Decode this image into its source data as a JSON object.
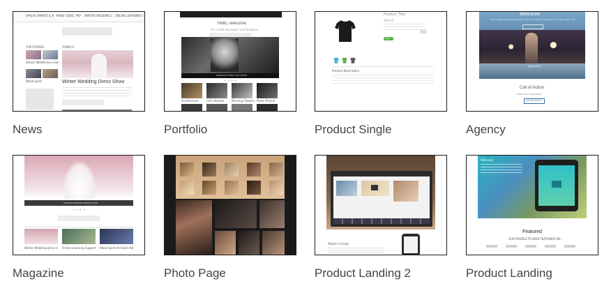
{
  "templates": [
    {
      "label": "News"
    },
    {
      "label": "Portfolio"
    },
    {
      "label": "Product Single"
    },
    {
      "label": "Agency"
    },
    {
      "label": "Magazine"
    },
    {
      "label": "Photo Page"
    },
    {
      "label": "Product Landing 2"
    },
    {
      "label": "Product Landing"
    }
  ],
  "thumbs": {
    "news": {
      "nav": [
        "SPAGIA SMARTS & NEW LOOK",
        "MAKE GOOD, PAP IN FIND",
        "WINTER WEDDING DRESS SHOW",
        "ONLINE LEARNING SUPPORT AND ADVICE"
      ],
      "top_stories": "TOP STORIES",
      "today": "TODAY'S",
      "story1": "Winter Wedding Dress Show",
      "story2": "Online Learning Support and Advice",
      "story3": "Wood Spirit Art Skills Nominated",
      "headline": "Winter Wedding Dress Show"
    },
    "portfolio": {
      "hello": "Hello, welcome.",
      "tagline": "I'm a web developer and designer.",
      "caption": "MORGAN'S NEW LOOK SHOW",
      "items": [
        "Architecture",
        "Lee Lifestyle",
        "Morning Flowers",
        "Photo Project"
      ]
    },
    "product_single": {
      "title": "Product Title",
      "price": "$99.00",
      "button": "BUY",
      "desc_title": "Product Description"
    },
    "agency": {
      "welcome": "Welcome",
      "intro": "Nam sagittis, elit egestas ullamcorper. Fringilla lacus at rhoncus vitae augue nisl.",
      "more": "READ MORE",
      "cta": "Call of Action",
      "cta_sub": "HERE OUR TEAM WORK",
      "button": "GET IN TOUCH"
    },
    "magazine": {
      "caption": "WINTER WEDDING DRESS SHOW",
      "stories": [
        "Winter Wedding Dress Show",
        "Online Learning Support and Advice",
        "Wood Spirit Art Skills Nominated"
      ]
    },
    "product_landing2": {
      "mobile": "Mobile Friendly"
    },
    "product_landing": {
      "welcome": "Welcome",
      "featured": "Featured",
      "featured_sub": "OUR PRODUCTS HAVE FEATURED ON..."
    }
  },
  "colors": {
    "label": "#444444",
    "border": "#1a1a1a",
    "accent_green": "#5fae4a",
    "agency_blue": "#2f6ea5",
    "landing_teal": "#2bb3c0"
  }
}
